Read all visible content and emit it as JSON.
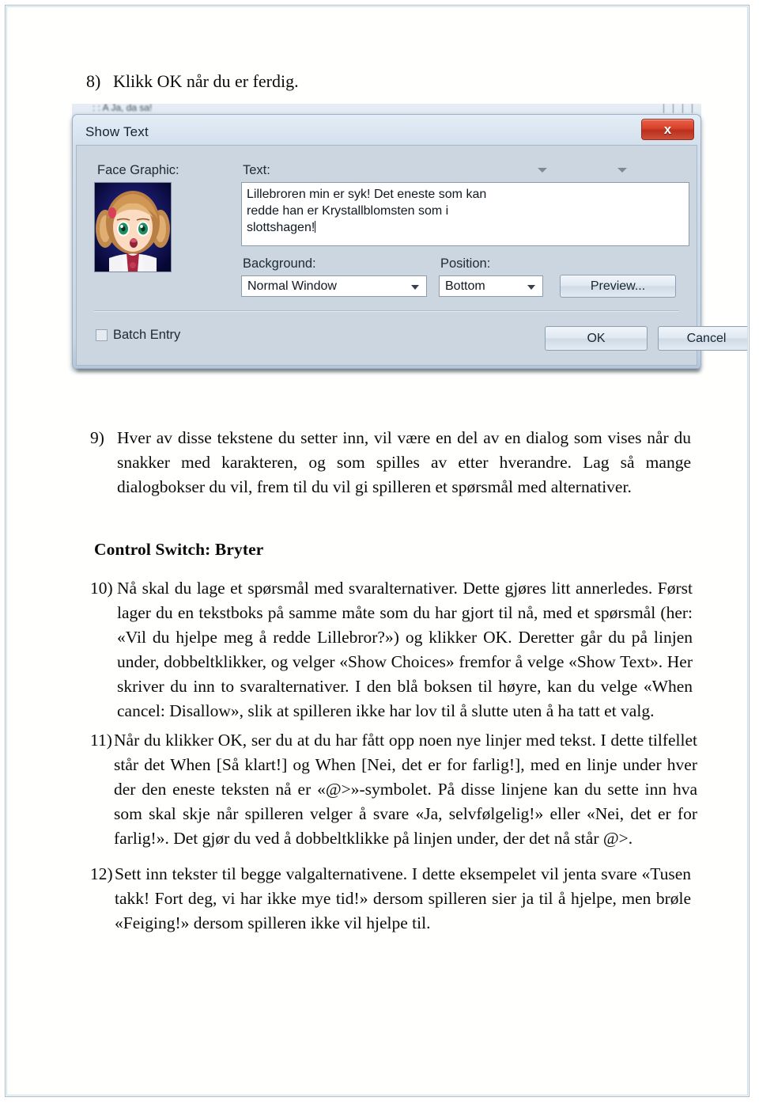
{
  "page": {
    "steps": [
      {
        "marker": "8)",
        "text": "Klikk OK når du er ferdig."
      },
      {
        "marker": "9)",
        "text": "Hver av disse tekstene du setter inn, vil være en del av en dialog som vises når du snakker med karakteren, og som spilles av etter hverandre. Lag så mange dialogbokser du vil, frem til du vil gi spilleren et spørsmål med alternativer."
      },
      {
        "marker": "10)",
        "text": "Nå skal du lage et spørsmål med svaralternativer. Dette gjøres litt annerledes. Først lager du en tekstboks på samme måte som du har gjort til nå, med et spørsmål (her: «Vil du hjelpe meg å redde Lillebror?») og klikker OK. Deretter går du på linjen under, dobbeltklikker, og velger «Show Choices» fremfor å velge «Show Text». Her skriver du inn to svaralternativer. I den blå boksen til høyre, kan du velge «When cancel: Disallow», slik at spilleren ikke har lov til å slutte uten å ha tatt et valg."
      },
      {
        "marker": "11)",
        "text": "Når du klikker OK, ser du at du har fått opp noen nye linjer med tekst. I dette tilfellet står det When [Så klart!] og When [Nei, det er for farlig!], med en linje under hver der den eneste teksten nå er «@>»-symbolet. På disse linjene kan du sette inn hva som skal skje når spilleren velger å svare «Ja, selvfølgelig!» eller «Nei, det er for farlig!». Det gjør du ved å dobbeltklikke på linjen under, der det nå står @>."
      },
      {
        "marker": "12)",
        "text": "Sett inn tekster til begge valgalternativene. I dette eksempelet vil jenta svare «Tusen takk! Fort deg, vi har ikke mye tid!» dersom spilleren sier ja til å hjelpe, men brøle «Feiging!» dersom spilleren ikke vil hjelpe til."
      }
    ],
    "heading_control_switch": "Control Switch: Bryter"
  },
  "screenshot": {
    "background_window_text": ":        : A Ja, da sa!",
    "dialog": {
      "title": "Show Text",
      "close_label": "x",
      "labels": {
        "face_graphic": "Face Graphic:",
        "text": "Text:",
        "background": "Background:",
        "position": "Position:"
      },
      "text_value_line1": "Lillebroren min er syk! Det eneste som kan",
      "text_value_line2": "redde han er Krystallblomsten som i",
      "text_value_line3": "slottshagen!",
      "background_value": "Normal Window",
      "position_value": "Bottom",
      "preview_label": "Preview...",
      "ok_label": "OK",
      "cancel_label": "Cancel",
      "batch_entry_label": "Batch Entry",
      "batch_entry_checked": false,
      "colors": {
        "dialog_face": "#ccd6e1",
        "close_button": "#d8402a",
        "field_background": "#ffffff",
        "portrait_background": "#0a0a46"
      }
    }
  }
}
